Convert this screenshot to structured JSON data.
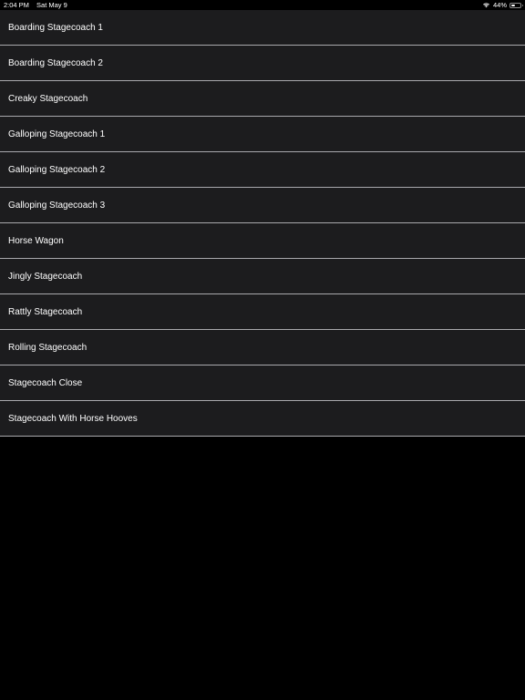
{
  "status_bar": {
    "time": "2:04 PM",
    "date": "Sat May 9",
    "battery_percent": "44%",
    "battery_level": 0.44,
    "icons": [
      "wifi-icon",
      "battery-icon"
    ]
  },
  "sounds": [
    {
      "label": "Boarding Stagecoach 1"
    },
    {
      "label": "Boarding Stagecoach 2"
    },
    {
      "label": "Creaky Stagecoach"
    },
    {
      "label": "Galloping Stagecoach 1"
    },
    {
      "label": "Galloping Stagecoach 2"
    },
    {
      "label": "Galloping Stagecoach 3"
    },
    {
      "label": "Horse Wagon"
    },
    {
      "label": "Jingly Stagecoach"
    },
    {
      "label": "Rattly Stagecoach"
    },
    {
      "label": "Rolling Stagecoach"
    },
    {
      "label": "Stagecoach Close"
    },
    {
      "label": "Stagecoach With Horse Hooves"
    }
  ],
  "colors": {
    "background": "#000000",
    "row_background": "#1c1c1e",
    "separator": "#a9a9ad",
    "text": "#ffffff"
  }
}
